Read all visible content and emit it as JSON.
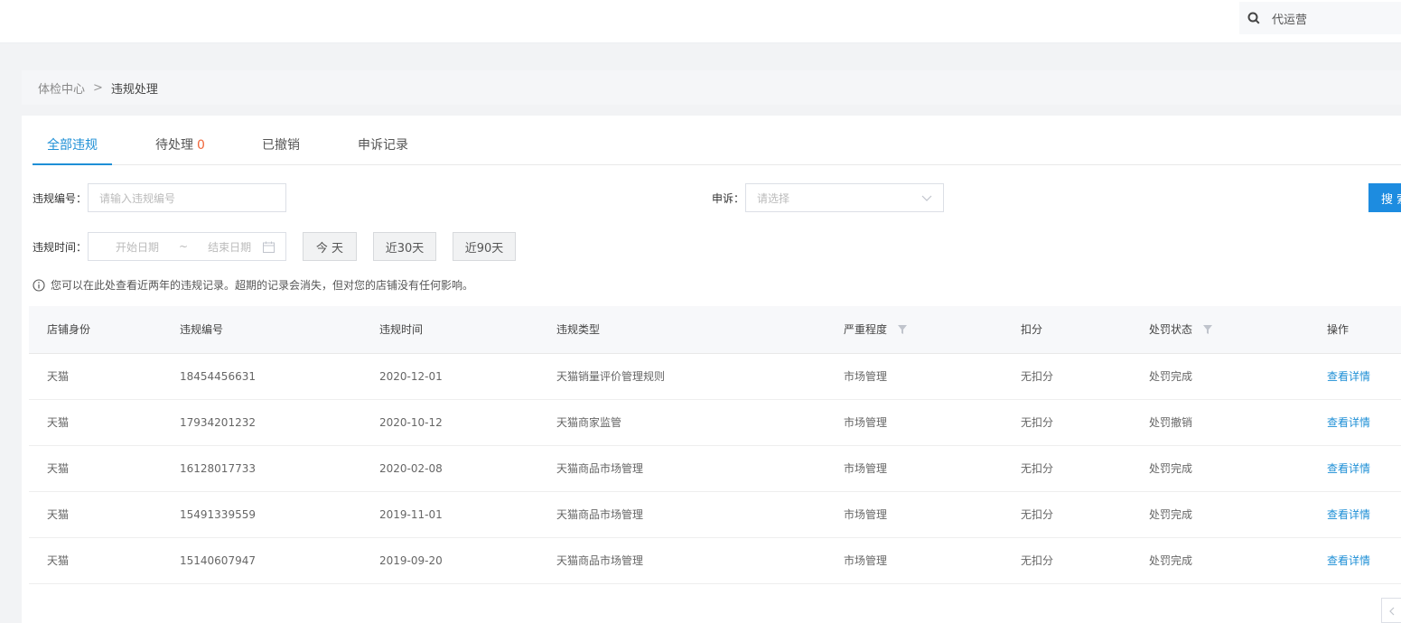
{
  "header": {
    "search_text": "代运营"
  },
  "breadcrumb": {
    "root": "体检中心",
    "separator": ">",
    "current": "违规处理"
  },
  "tabs": [
    {
      "label": "全部违规",
      "active": true
    },
    {
      "label": "待处理",
      "count": "0",
      "active": false
    },
    {
      "label": "已撤销",
      "active": false
    },
    {
      "label": "申诉记录",
      "active": false
    }
  ],
  "filters": {
    "violation_no_label": "违规编号：",
    "violation_no_placeholder": "请输入违规编号",
    "appeal_label": "申诉：",
    "appeal_placeholder": "请选择",
    "search_button": "搜 索",
    "time_label": "违规时间：",
    "start_date_placeholder": "开始日期",
    "date_separator": "~",
    "end_date_placeholder": "结束日期",
    "quick_ranges": [
      "今 天",
      "近30天",
      "近90天"
    ]
  },
  "notice": "您可以在此处查看近两年的违规记录。超期的记录会消失，但对您的店铺没有任何影响。",
  "table": {
    "columns": [
      "店铺身份",
      "违规编号",
      "违规时间",
      "违规类型",
      "严重程度",
      "扣分",
      "处罚状态",
      "操作"
    ],
    "rows": [
      [
        "天猫",
        "18454456631",
        "2020-12-01",
        "天猫销量评价管理规则",
        "市场管理",
        "无扣分",
        "处罚完成",
        "查看详情"
      ],
      [
        "天猫",
        "17934201232",
        "2020-10-12",
        "天猫商家监管",
        "市场管理",
        "无扣分",
        "处罚撤销",
        "查看详情"
      ],
      [
        "天猫",
        "16128017733",
        "2020-02-08",
        "天猫商品市场管理",
        "市场管理",
        "无扣分",
        "处罚完成",
        "查看详情"
      ],
      [
        "天猫",
        "15491339559",
        "2019-11-01",
        "天猫商品市场管理",
        "市场管理",
        "无扣分",
        "处罚完成",
        "查看详情"
      ],
      [
        "天猫",
        "15140607947",
        "2019-09-20",
        "天猫商品市场管理",
        "市场管理",
        "无扣分",
        "处罚完成",
        "查看详情"
      ]
    ]
  },
  "colors": {
    "accent": "#1e8fd6",
    "count": "#f0663a"
  }
}
